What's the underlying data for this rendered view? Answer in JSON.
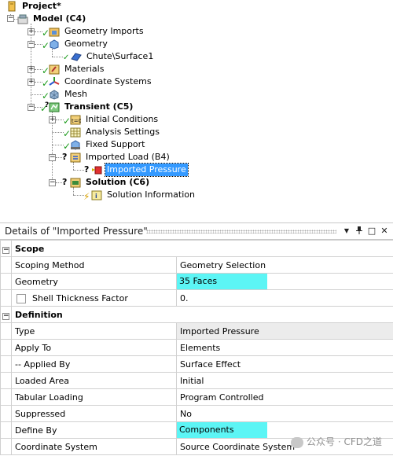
{
  "tree": {
    "project": "Project*",
    "model": "Model (C4)",
    "geometry_imports": "Geometry Imports",
    "geometry": "Geometry",
    "chute_surface": "Chute\\Surface1",
    "materials": "Materials",
    "coordinate_systems": "Coordinate Systems",
    "mesh": "Mesh",
    "transient": "Transient (C5)",
    "initial_conditions": "Initial Conditions",
    "analysis_settings": "Analysis Settings",
    "fixed_support": "Fixed Support",
    "imported_load": "Imported Load (B4)",
    "imported_pressure": "Imported Pressure",
    "solution": "Solution (C6)",
    "solution_information": "Solution Information"
  },
  "details": {
    "title": "Details of \"Imported Pressure\"",
    "buttons": {
      "dropdown": "▼",
      "pin": "ᵖ",
      "restore": "□",
      "close": "✕"
    },
    "sections": [
      {
        "name": "Scope",
        "rows": [
          {
            "prop": "Scoping Method",
            "value": "Geometry Selection"
          },
          {
            "prop": "Geometry",
            "value": "35 Faces"
          },
          {
            "prop": "Shell Thickness Factor",
            "value": "0."
          }
        ]
      },
      {
        "name": "Definition",
        "rows": [
          {
            "prop": "Type",
            "value": "Imported Pressure"
          },
          {
            "prop": "Apply To",
            "value": "Elements"
          },
          {
            "prop": "-- Applied By",
            "value": "Surface Effect"
          },
          {
            "prop": "Loaded Area",
            "value": "Initial"
          },
          {
            "prop": "Tabular Loading",
            "value": "Program Controlled"
          },
          {
            "prop": "Suppressed",
            "value": "No"
          },
          {
            "prop": "Define By",
            "value": "Components"
          },
          {
            "prop": "Coordinate System",
            "value": "Source Coordinate System"
          }
        ]
      }
    ]
  },
  "watermark": "公众号 · CFD之道",
  "colors": {
    "highlight": "#5cf5f5",
    "selection": "#3399ff",
    "check": "#1a9a1a"
  }
}
